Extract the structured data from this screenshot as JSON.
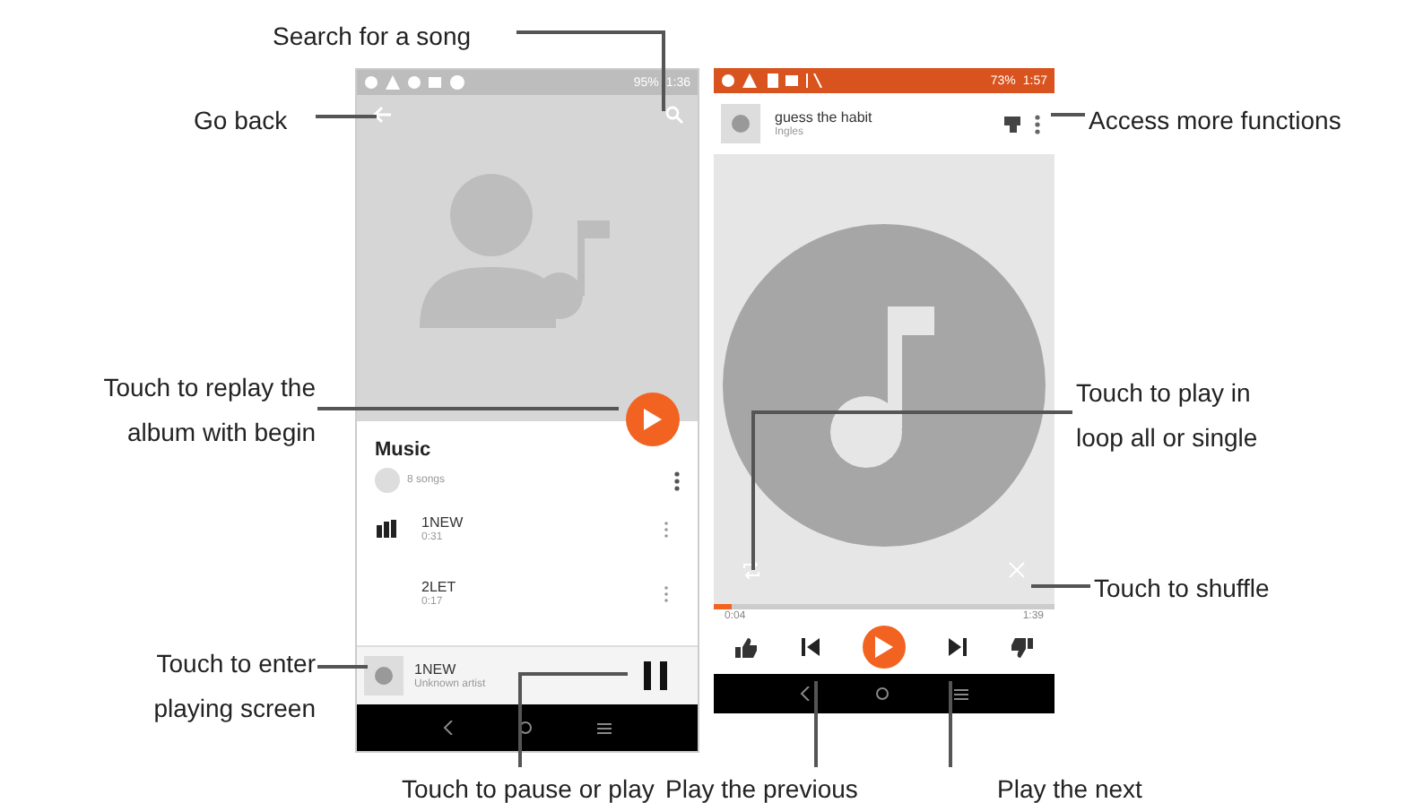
{
  "callouts": [
    {
      "text": "Search for a song"
    },
    {
      "text": "Go back"
    },
    {
      "text": "Touch to replay the\nalbum with begin"
    },
    {
      "text": "Touch to enter\nplaying screen"
    },
    {
      "text": "Touch to pause or play"
    },
    {
      "text": "Access more functions"
    },
    {
      "text": "Touch to play in\nloop all or single"
    },
    {
      "text": "Touch to shuffle"
    },
    {
      "text": "Play the previous"
    },
    {
      "text": "Play the next"
    }
  ],
  "album_screen": {
    "status_bar": {
      "battery": "95%",
      "time": "1:36"
    },
    "title": "Music",
    "song_count": "8 songs",
    "songs": [
      {
        "title": "1NEW",
        "duration": "0:31",
        "playing": true
      },
      {
        "title": "2LET",
        "duration": "0:17",
        "playing": false
      }
    ],
    "mini_player": {
      "title": "1NEW",
      "artist": "Unknown artist",
      "playing": true
    }
  },
  "player_screen": {
    "status_bar": {
      "battery": "73%",
      "time": "1:57"
    },
    "title": "guess the habit",
    "artist": "Ingles",
    "progress": {
      "level": 0.05,
      "elapsed": "0:04",
      "total": "1:39"
    },
    "playing": false
  }
}
